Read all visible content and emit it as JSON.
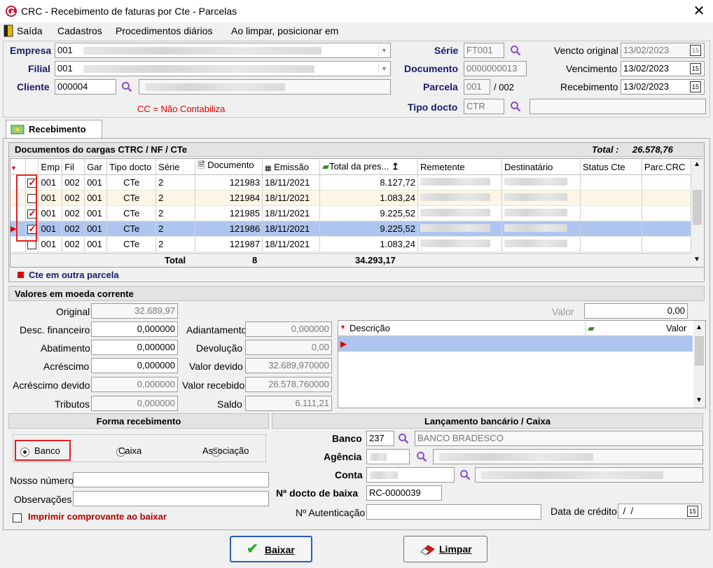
{
  "window": {
    "title": "CRC - Recebimento de faturas por Cte - Parcelas"
  },
  "menu": {
    "items": [
      "Saída",
      "Cadastros",
      "Procedimentos diários",
      "Ao limpar, posicionar em"
    ]
  },
  "header": {
    "empresa_label": "Empresa",
    "empresa_value": "001",
    "filial_label": "Filial",
    "filial_value": "001",
    "cliente_label": "Cliente",
    "cliente_value": "000004",
    "cc_note": "CC = Não Contabiliza",
    "serie_label": "Série",
    "serie_value": "FT001",
    "documento_label": "Documento",
    "documento_value": "0000000013",
    "parcela_label": "Parcela",
    "parcela_value": "001",
    "parcela_total": "/ 002",
    "tipo_docto_label": "Tipo docto",
    "tipo_docto_value": "CTR",
    "vencto_original_label": "Vencto original",
    "vencto_original_value": "13/02/2023",
    "vencimento_label": "Vencimento",
    "vencimento_value": "13/02/2023",
    "recebimento_label": "Recebimento",
    "recebimento_value": "13/02/2023",
    "cal_icon": "15"
  },
  "tab": {
    "label": "Recebimento"
  },
  "documents": {
    "title": "Documentos do cargas CTRC / NF / CTe",
    "total_label": "Total :",
    "total_value": "26.578,76",
    "columns": [
      "Emp",
      "Fil",
      "Gar",
      "Tipo docto",
      "Série",
      "Documento",
      "Emissão",
      "Total da pres...",
      "Remetente",
      "Destinatário",
      "Status Cte",
      "Parc.CRC"
    ],
    "rows": [
      {
        "checked": true,
        "emp": "001",
        "fil": "002",
        "gar": "001",
        "tipo": "CTe",
        "serie": "2",
        "documento": "121983",
        "emissao": "18/11/2021",
        "total": "8.127,72"
      },
      {
        "checked": false,
        "emp": "001",
        "fil": "002",
        "gar": "001",
        "tipo": "CTe",
        "serie": "2",
        "documento": "121984",
        "emissao": "18/11/2021",
        "total": "1.083,24"
      },
      {
        "checked": true,
        "emp": "001",
        "fil": "002",
        "gar": "001",
        "tipo": "CTe",
        "serie": "2",
        "documento": "121985",
        "emissao": "18/11/2021",
        "total": "9.225,52"
      },
      {
        "checked": true,
        "emp": "001",
        "fil": "002",
        "gar": "001",
        "tipo": "CTe",
        "serie": "2",
        "documento": "121986",
        "emissao": "18/11/2021",
        "total": "9.225,52"
      },
      {
        "checked": false,
        "emp": "001",
        "fil": "002",
        "gar": "001",
        "tipo": "CTe",
        "serie": "2",
        "documento": "121987",
        "emissao": "18/11/2021",
        "total": "1.083,24"
      }
    ],
    "footer_label": "Total",
    "footer_count": "8",
    "footer_total": "34.293,17",
    "legend": "Cte em outra parcela"
  },
  "valores": {
    "title": "Valores em moeda corrente",
    "original_label": "Original",
    "original_value": "32.689,97",
    "desc_fin_label": "Desc. financeiro",
    "desc_fin_value": "0,000000",
    "abatimento_label": "Abatimento",
    "abatimento_value": "0,000000",
    "acrescimo_label": "Acréscimo",
    "acrescimo_value": "0,000000",
    "acrescimo_devido_label": "Acréscimo devido",
    "acrescimo_devido_value": "0,000000",
    "tributos_label": "Tributos",
    "tributos_value": "0,000000",
    "adiantamento_label": "Adiantamento",
    "adiantamento_value": "0,000000",
    "devolucao_label": "Devolução",
    "devolucao_value": "0,00",
    "valor_devido_label": "Valor devido",
    "valor_devido_value": "32.689,970000",
    "valor_recebido_label": "Valor recebido",
    "valor_recebido_value": "26.578,760000",
    "saldo_label": "Saldo",
    "saldo_value": "6.111,21",
    "valor_label": "Valor",
    "valor_value": "0,00",
    "desc_col": "Descrição",
    "valor_col": "Valor"
  },
  "forma": {
    "title": "Forma recebimento",
    "options": [
      "Banco",
      "Caixa",
      "Associação"
    ],
    "selected": "Banco",
    "nosso_numero_label": "Nosso número",
    "observacoes_label": "Observações",
    "imprimir_label": "Imprimir comprovante ao baixar"
  },
  "lancamento": {
    "title": "Lançamento bancário / Caixa",
    "banco_label": "Banco",
    "banco_value": "237",
    "banco_nome": "BANCO BRADESCO",
    "agencia_label": "Agência",
    "conta_label": "Conta",
    "docto_baixa_label": "Nº docto de baixa",
    "docto_baixa_value": "RC-0000039",
    "autenticacao_label": "Nº Autenticação",
    "data_credito_label": "Data de crédito",
    "data_credito_value": " /  /"
  },
  "buttons": {
    "baixar": "Baixar",
    "limpar": "Limpar"
  }
}
